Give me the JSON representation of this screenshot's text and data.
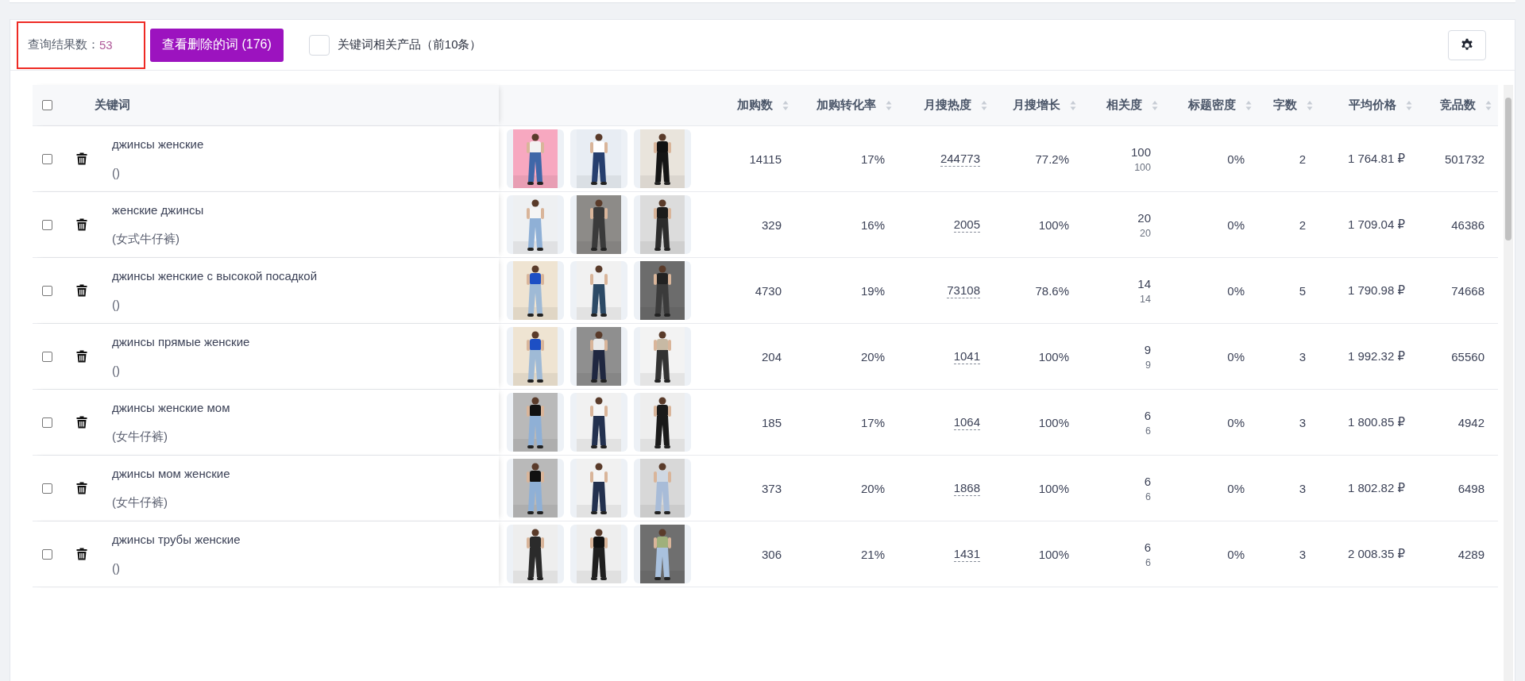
{
  "toolbar": {
    "result_count": {
      "label": "查询结果数：",
      "value": "53",
      "highlighted": true
    },
    "deleted_button": "查看删除的词 (176)",
    "related_products": {
      "label": "关键词相关产品（前10条）",
      "checked": false
    }
  },
  "table": {
    "select_all": {
      "checked": false
    },
    "keyword_header": "关键词",
    "columns": [
      "加购数",
      "加购转化率",
      "月搜热度",
      "月搜增长",
      "相关度",
      "标题密度",
      "字数",
      "平均价格",
      "竞品数"
    ],
    "rows": [
      {
        "checked": false,
        "keyword": "джинсы женские",
        "translation": "()",
        "add_to_cart": "14115",
        "conversion": "17%",
        "monthly_searches": "244773",
        "growth": "77.2%",
        "relevance": "100",
        "relevance_sub": "100",
        "title_density": "0%",
        "word_count": "2",
        "avg_price": "1 764.81 ₽",
        "competitors": "501732"
      },
      {
        "checked": false,
        "keyword": "женские джинсы",
        "translation": "(女式牛仔裤)",
        "add_to_cart": "329",
        "conversion": "16%",
        "monthly_searches": "2005",
        "growth": "100%",
        "relevance": "20",
        "relevance_sub": "20",
        "title_density": "0%",
        "word_count": "2",
        "avg_price": "1 709.04 ₽",
        "competitors": "46386"
      },
      {
        "checked": false,
        "keyword": "джинсы женские с высокой посадкой",
        "translation": "()",
        "add_to_cart": "4730",
        "conversion": "19%",
        "monthly_searches": "73108",
        "growth": "78.6%",
        "relevance": "14",
        "relevance_sub": "14",
        "title_density": "0%",
        "word_count": "5",
        "avg_price": "1 790.98 ₽",
        "competitors": "74668"
      },
      {
        "checked": false,
        "keyword": "джинсы прямые женские",
        "translation": "()",
        "add_to_cart": "204",
        "conversion": "20%",
        "monthly_searches": "1041",
        "growth": "100%",
        "relevance": "9",
        "relevance_sub": "9",
        "title_density": "0%",
        "word_count": "3",
        "avg_price": "1 992.32 ₽",
        "competitors": "65560"
      },
      {
        "checked": false,
        "keyword": "джинсы женские мом",
        "translation": "(女牛仔裤)",
        "add_to_cart": "185",
        "conversion": "17%",
        "monthly_searches": "1064",
        "growth": "100%",
        "relevance": "6",
        "relevance_sub": "6",
        "title_density": "0%",
        "word_count": "3",
        "avg_price": "1 800.85 ₽",
        "competitors": "4942"
      },
      {
        "checked": false,
        "keyword": "джинсы мом женские",
        "translation": "(女牛仔裤)",
        "add_to_cart": "373",
        "conversion": "20%",
        "monthly_searches": "1868",
        "growth": "100%",
        "relevance": "6",
        "relevance_sub": "6",
        "title_density": "0%",
        "word_count": "3",
        "avg_price": "1 802.82 ₽",
        "competitors": "6498"
      },
      {
        "checked": false,
        "keyword": "джинсы трубы женские",
        "translation": "()",
        "add_to_cart": "306",
        "conversion": "21%",
        "monthly_searches": "1431",
        "growth": "100%",
        "relevance": "6",
        "relevance_sub": "6",
        "title_density": "0%",
        "word_count": "3",
        "avg_price": "2 008.35 ₽",
        "competitors": "4289"
      }
    ]
  }
}
